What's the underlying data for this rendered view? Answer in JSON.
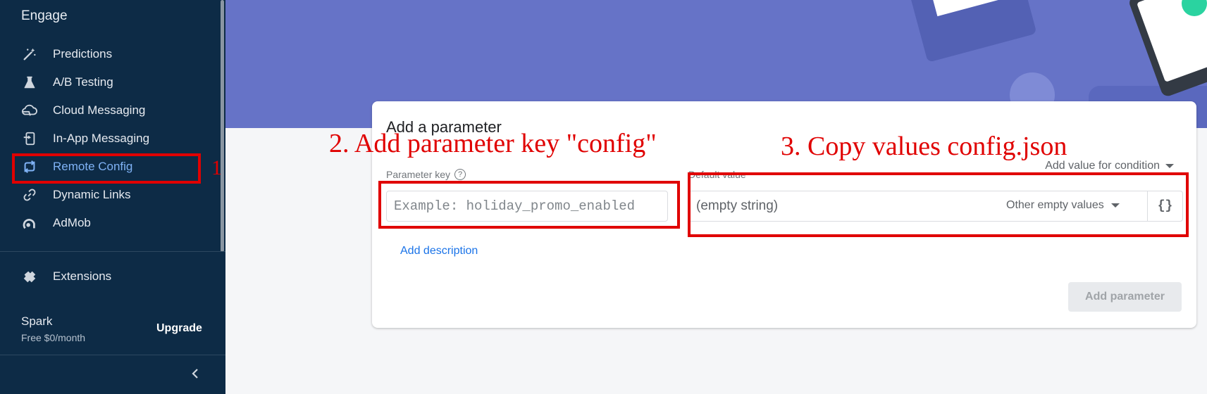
{
  "sidebar": {
    "section_title": "Engage",
    "items": [
      {
        "label": "Predictions",
        "icon": "magic-wand-icon"
      },
      {
        "label": "A/B Testing",
        "icon": "flask-icon"
      },
      {
        "label": "Cloud Messaging",
        "icon": "cloud-message-icon"
      },
      {
        "label": "In-App Messaging",
        "icon": "in-app-message-icon"
      },
      {
        "label": "Remote Config",
        "icon": "remote-config-icon",
        "active": true
      },
      {
        "label": "Dynamic Links",
        "icon": "link-icon"
      },
      {
        "label": "AdMob",
        "icon": "admob-icon"
      }
    ],
    "extensions_label": "Extensions",
    "plan": {
      "name": "Spark",
      "price": "Free $0/month",
      "upgrade_label": "Upgrade"
    }
  },
  "card": {
    "title": "Add a parameter",
    "parameter_key_label": "Parameter key",
    "parameter_key_placeholder": "Example: holiday_promo_enabled",
    "default_value_label": "Default value",
    "add_value_for_condition": "Add value for condition",
    "value_placeholder": "(empty string)",
    "other_empty_values": "Other empty values",
    "json_button": "{}",
    "add_description": "Add description",
    "add_parameter": "Add parameter"
  },
  "annotations": {
    "step1": "1",
    "step2": "2. Add parameter key \"config\"",
    "step3": "3. Copy values config.json"
  },
  "colors": {
    "sidebar_bg": "#0d2b46",
    "hero_bg": "#6673c7",
    "active_nav": "#7fb2f5",
    "link_blue": "#1a73e8",
    "annotation_red": "#e00000"
  }
}
